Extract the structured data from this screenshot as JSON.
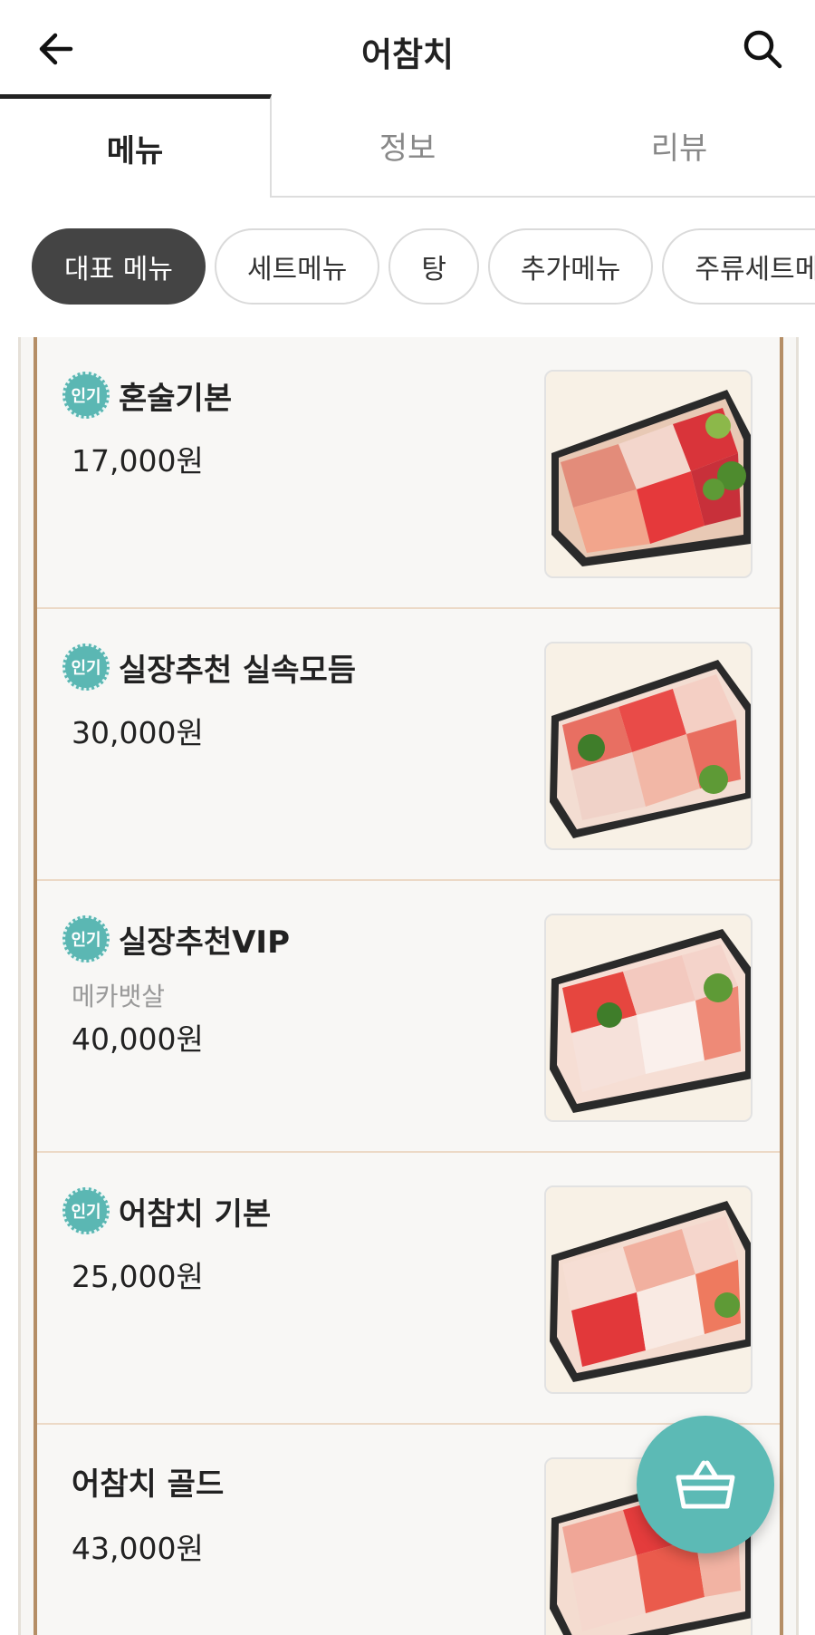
{
  "header": {
    "title": "어참치",
    "back_icon": "arrow-left-icon",
    "search_icon": "search-icon"
  },
  "tabs": [
    {
      "label": "메뉴",
      "active": true
    },
    {
      "label": "정보",
      "active": false
    },
    {
      "label": "리뷰",
      "active": false
    }
  ],
  "categories": [
    {
      "label": "대표 메뉴",
      "active": true
    },
    {
      "label": "세트메뉴",
      "active": false
    },
    {
      "label": "탕",
      "active": false
    },
    {
      "label": "추가메뉴",
      "active": false
    },
    {
      "label": "주류세트메뉴",
      "active": false
    }
  ],
  "badge_label": "인기",
  "items": [
    {
      "name": "혼술기본",
      "description": "",
      "price": "17,000원",
      "popular": true
    },
    {
      "name": "실장추천 실속모듬",
      "description": "",
      "price": "30,000원",
      "popular": true
    },
    {
      "name": "실장추천VIP",
      "description": "메카뱃살",
      "price": "40,000원",
      "popular": true
    },
    {
      "name": "어참치 기본",
      "description": "",
      "price": "25,000원",
      "popular": true
    },
    {
      "name": "어참치 골드",
      "description": "",
      "price": "43,000원",
      "popular": false
    }
  ],
  "cart_icon": "shopping-basket-icon",
  "colors": {
    "accent": "#5bb7b3",
    "frame": "#b58e66",
    "chip_active": "#444444"
  }
}
